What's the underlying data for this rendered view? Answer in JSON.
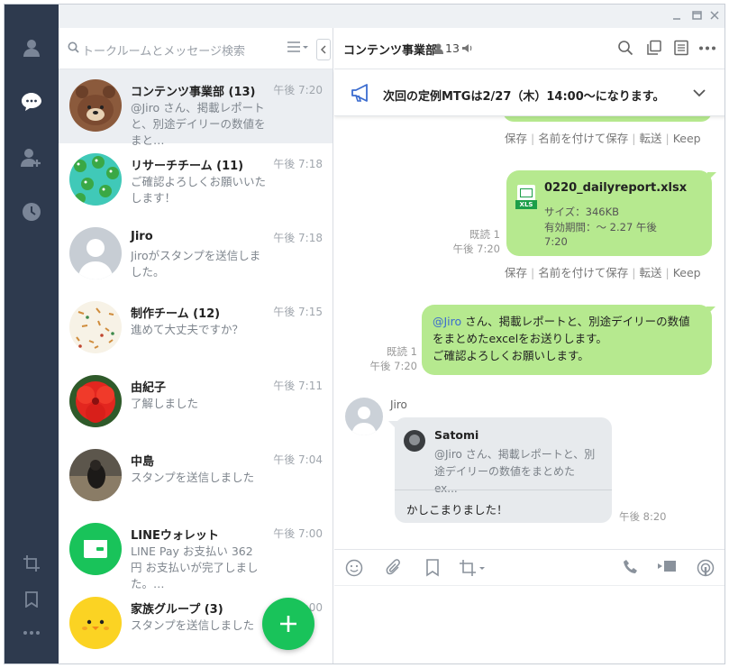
{
  "sidebar": {
    "items": [
      "friends-icon",
      "chats-icon",
      "add-friend-icon",
      "history-icon"
    ],
    "bottom": [
      "crop-icon",
      "bookmark-icon",
      "more-icon"
    ]
  },
  "search": {
    "placeholder": "トークルームとメッセージ検索"
  },
  "chats": [
    {
      "name": "コンテンツ事業部 (13)",
      "time": "午後 7:20",
      "msg": "@Jiro さん、掲載レポートと、別途デイリーの数値をまと…",
      "avatar": "bear",
      "selected": true
    },
    {
      "name": "リサーチチーム (11)",
      "time": "午後 7:18",
      "msg": "ご確認よろしくお願いいたします！",
      "avatar": "frogs"
    },
    {
      "name": "Jiro",
      "time": "午後 7:18",
      "msg": "Jiroがスタンプを送信しました。",
      "avatar": "default"
    },
    {
      "name": "制作チーム (12)",
      "time": "午後 7:15",
      "msg": "進めて大丈夫ですか？",
      "avatar": "pattern"
    },
    {
      "name": "由紀子",
      "time": "午後 7:11",
      "msg": "了解しました",
      "avatar": "flower"
    },
    {
      "name": "中島",
      "time": "午後 7:04",
      "msg": "スタンプを送信しました",
      "avatar": "dark"
    },
    {
      "name": "LINEウォレット",
      "time": "午後 7:00",
      "msg": "LINE Pay お支払い 362 円 お支払いが完了しました。…",
      "avatar": "wallet"
    },
    {
      "name": "家族グループ (3)",
      "time": "午後 7:00",
      "msg": "スタンプを送信しました",
      "avatar": "chick"
    }
  ],
  "chat": {
    "title": "コンテンツ事業部",
    "members": "13",
    "notice": "次回の定例MTGは2/27（木）14:00～になります。",
    "actions": {
      "save": "保存",
      "save_as": "名前を付けて保存",
      "forward": "転送",
      "keep": "Keep"
    },
    "file": {
      "name": "0220_dailyreport.xlsx",
      "size": "サイズ：346KB",
      "expiry": "有効期間：～ 2.27 午後 7:20",
      "badge": "XLS"
    },
    "file_meta": {
      "read": "既読 1",
      "time": "午後 7:20"
    },
    "msg1": {
      "mention": "@Jiro",
      "text1": " さん、掲載レポートと、別途デイリーの数値をまとめたexcelをお送りします。",
      "text2": "ご確認よろしくお願いします。",
      "read": "既読 1",
      "time": "午後 7:20"
    },
    "reply": {
      "sender": "Jiro",
      "quote_name": "Satomi",
      "quote_text": "@Jiro さん、掲載レポートと、別途デイリーの数値をまとめたex...",
      "text": "かしこまりました！",
      "time": "午後 8:20"
    }
  },
  "colors": {
    "rail": "#2e3a4e",
    "bubble": "#b6e98f",
    "fab": "#19c35a",
    "accent": "#3b6ccf"
  }
}
